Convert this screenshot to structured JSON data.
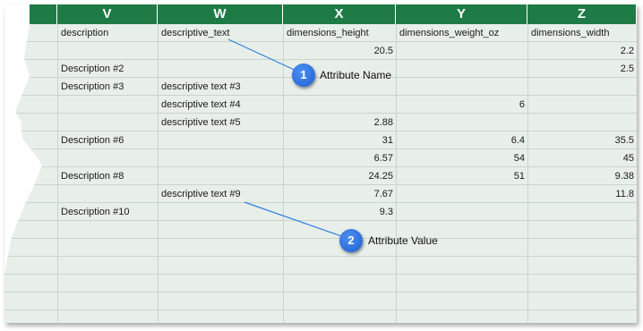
{
  "columns": [
    "V",
    "W",
    "X",
    "Y",
    "Z"
  ],
  "header_row": [
    "description",
    "descriptive_text",
    "dimensions_height",
    "dimensions_weight_oz",
    "dimensions_width"
  ],
  "rows": [
    [
      "",
      "",
      "20.5",
      "",
      "2.2"
    ],
    [
      "Description #2",
      "",
      "",
      "",
      "2.5"
    ],
    [
      "Description #3",
      "descriptive text #3",
      "",
      "",
      ""
    ],
    [
      "",
      "descriptive text #4",
      "",
      "6",
      ""
    ],
    [
      "",
      "descriptive text #5",
      "2.88",
      "",
      ""
    ],
    [
      "Description #6",
      "",
      "31",
      "6.4",
      "35.5"
    ],
    [
      "",
      "",
      "6.57",
      "54",
      "45"
    ],
    [
      "Description #8",
      "",
      "24.25",
      "51",
      "9.38"
    ],
    [
      "",
      "descriptive text #9",
      "7.67",
      "",
      "11.8"
    ],
    [
      "Description #10",
      "",
      "9.3",
      "",
      ""
    ]
  ],
  "callouts": [
    {
      "number": "1",
      "label": "Attribute Name"
    },
    {
      "number": "2",
      "label": "Attribute Value"
    }
  ],
  "colors": {
    "header_bg": "#1e7b46",
    "callout": "#1a5fd1",
    "sheet_bg": "#e8efe9"
  }
}
